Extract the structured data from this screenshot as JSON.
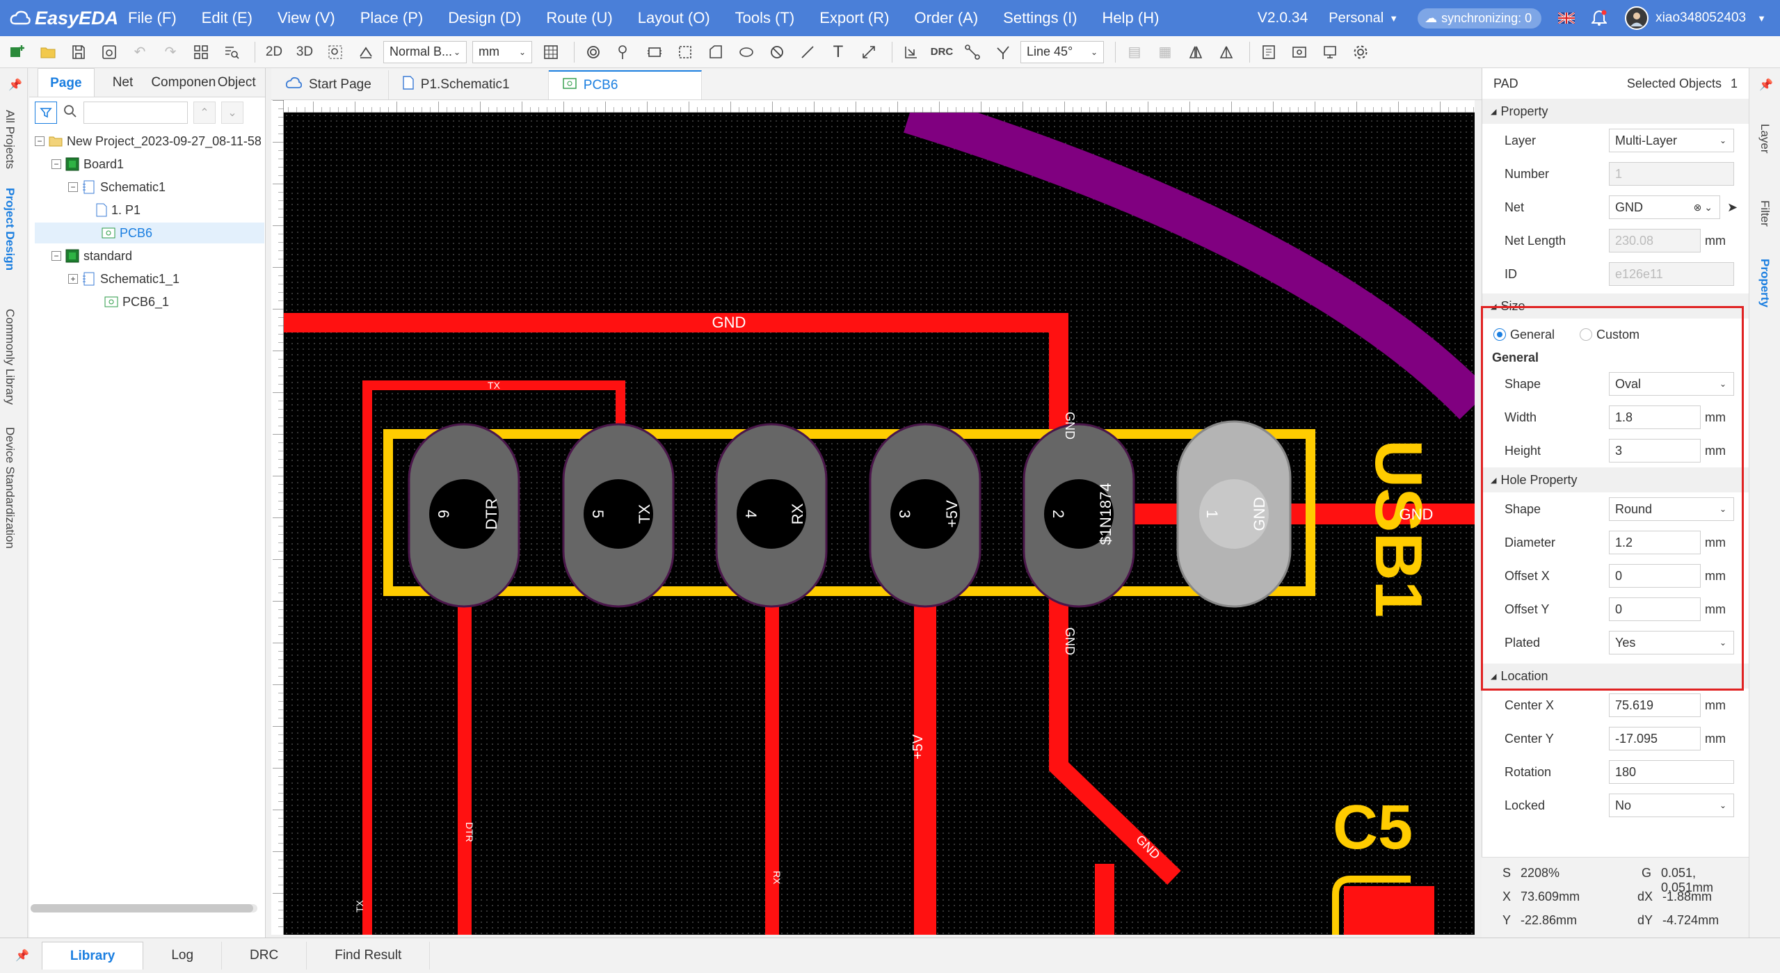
{
  "app": {
    "name": "EasyEDA",
    "version": "V2.0.34",
    "workspace": "Personal",
    "sync_status": "synchronizing: 0",
    "username": "xiao348052403"
  },
  "menu": [
    "File (F)",
    "Edit (E)",
    "View (V)",
    "Place (P)",
    "Design (D)",
    "Route (U)",
    "Layout (O)",
    "Tools (T)",
    "Export (R)",
    "Order (A)",
    "Settings (I)",
    "Help (H)"
  ],
  "toolbar": {
    "view_2d": "2D",
    "view_3d": "3D",
    "select_mode": "Normal B...",
    "unit": "mm",
    "drc_label": "DRC",
    "route_mode": "Line 45°"
  },
  "left_vtabs": [
    "All Projects",
    "Project Design",
    "Commonly Library",
    "Device Standardization"
  ],
  "left_panel": {
    "tabs": [
      "Page",
      "Net",
      "Componen",
      "Object"
    ],
    "tree": [
      {
        "label": "New Project_2023-09-27_08-11-58"
      },
      {
        "label": "Board1"
      },
      {
        "label": "Schematic1"
      },
      {
        "label": "1. P1"
      },
      {
        "label": "PCB6"
      },
      {
        "label": "standard"
      },
      {
        "label": "Schematic1_1"
      },
      {
        "label": "PCB6_1"
      }
    ]
  },
  "editor_tabs": [
    "Start Page",
    "P1.Schematic1",
    "PCB6"
  ],
  "pcb": {
    "net_gnd": "GND",
    "trace_labels": {
      "tx": "TX",
      "dtr": "DTR",
      "rx": "RX",
      "v5": "+5V"
    },
    "designators": {
      "usb": "USB1",
      "cap": "C5"
    },
    "pads": [
      {
        "number": "6",
        "net": "DTR"
      },
      {
        "number": "5",
        "net": "TX"
      },
      {
        "number": "4",
        "net": "RX"
      },
      {
        "number": "3",
        "net": "+5V"
      },
      {
        "number": "2",
        "net": "$1N1874"
      },
      {
        "number": "1",
        "net": "GND"
      }
    ],
    "colors": {
      "copper_top": "#ff1111",
      "silkscreen": "#ffcc00",
      "pad": "#666666",
      "pad_selected": "#b4b4b4",
      "outline": "#800080"
    }
  },
  "right_panel": {
    "title": "PAD",
    "selected_label": "Selected Objects",
    "selected_count": "1",
    "property_section": "Property",
    "layer_label": "Layer",
    "layer_value": "Multi-Layer",
    "number_label": "Number",
    "number_value": "1",
    "net_label": "Net",
    "net_value": "GND",
    "net_length_label": "Net Length",
    "net_length_value": "230.08",
    "net_length_unit": "mm",
    "id_label": "ID",
    "id_value": "e126e11",
    "size_section": "Size",
    "size_general": "General",
    "size_custom": "Custom",
    "general_heading": "General",
    "shape_label": "Shape",
    "shape_value": "Oval",
    "width_label": "Width",
    "width_value": "1.8",
    "width_unit": "mm",
    "height_label": "Height",
    "height_value": "3",
    "height_unit": "mm",
    "hole_section": "Hole Property",
    "hole_shape_label": "Shape",
    "hole_shape_value": "Round",
    "diameter_label": "Diameter",
    "diameter_value": "1.2",
    "diameter_unit": "mm",
    "offset_x_label": "Offset X",
    "offset_x_value": "0",
    "offset_x_unit": "mm",
    "offset_y_label": "Offset Y",
    "offset_y_value": "0",
    "offset_y_unit": "mm",
    "plated_label": "Plated",
    "plated_value": "Yes",
    "location_section": "Location",
    "center_x_label": "Center X",
    "center_x_value": "75.619",
    "center_x_unit": "mm",
    "center_y_label": "Center Y",
    "center_y_value": "-17.095",
    "center_y_unit": "mm",
    "rotation_label": "Rotation",
    "rotation_value": "180",
    "locked_label": "Locked",
    "locked_value": "No"
  },
  "status": {
    "scale_label": "S",
    "scale": "2208%",
    "grid_label": "G",
    "grid": "0.051, 0.051mm",
    "x_label": "X",
    "x": "73.609mm",
    "dx_label": "dX",
    "dx": "-1.88mm",
    "y_label": "Y",
    "y": "-22.86mm",
    "dy_label": "dY",
    "dy": "-4.724mm"
  },
  "right_vtabs": [
    "Layer",
    "Filter",
    "Property"
  ],
  "bottom_tabs": [
    "Library",
    "Log",
    "DRC",
    "Find Result"
  ]
}
